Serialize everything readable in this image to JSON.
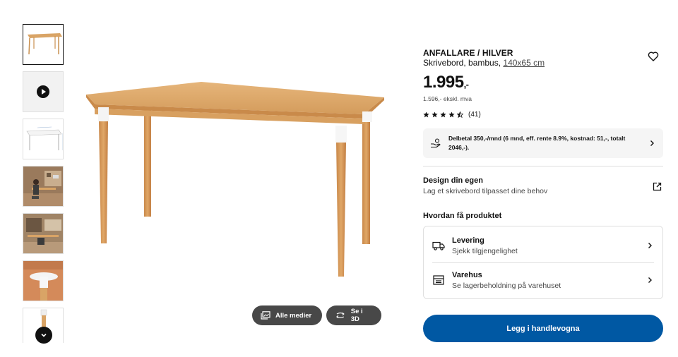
{
  "thumbnails": [
    {
      "name": "thumb-desk-front"
    },
    {
      "name": "thumb-video"
    },
    {
      "name": "thumb-desk-dimensions"
    },
    {
      "name": "thumb-room-person"
    },
    {
      "name": "thumb-room-desk"
    },
    {
      "name": "thumb-leg-closeup"
    },
    {
      "name": "thumb-leg-detail"
    }
  ],
  "media_buttons": {
    "all_media_label": "Alle medier",
    "view_3d_label": "Se i 3D"
  },
  "product": {
    "title": "ANFALLARE / HILVER",
    "subtitle_prefix": "Skrivebord, bambus,",
    "dimensions": "140x65 cm",
    "price_main": "1.995",
    "price_suffix": ",-",
    "price_ex_vat": "1.596,- ekskl. mva",
    "rating_value": 4.5,
    "rating_count": "(41)"
  },
  "finance": {
    "text": "Delbetal 350,-/mnd (6 mnd, eff. rente 8.9%, kostnad: 51,-, totalt 2046,-)."
  },
  "design": {
    "heading": "Design din egen",
    "subtext": "Lag et skrivebord tilpasset dine behov"
  },
  "how_to_get": {
    "heading": "Hvordan få produktet",
    "options": [
      {
        "title": "Levering",
        "subtitle": "Sjekk tilgjengelighet",
        "icon": "truck-icon"
      },
      {
        "title": "Varehus",
        "subtitle": "Se lagerbeholdning på varehuset",
        "icon": "store-icon"
      }
    ]
  },
  "cart": {
    "label": "Legg i handlevogna"
  },
  "colors": {
    "accent": "#0058a3",
    "media_button": "#484848",
    "bamboo": "#d9a466"
  }
}
